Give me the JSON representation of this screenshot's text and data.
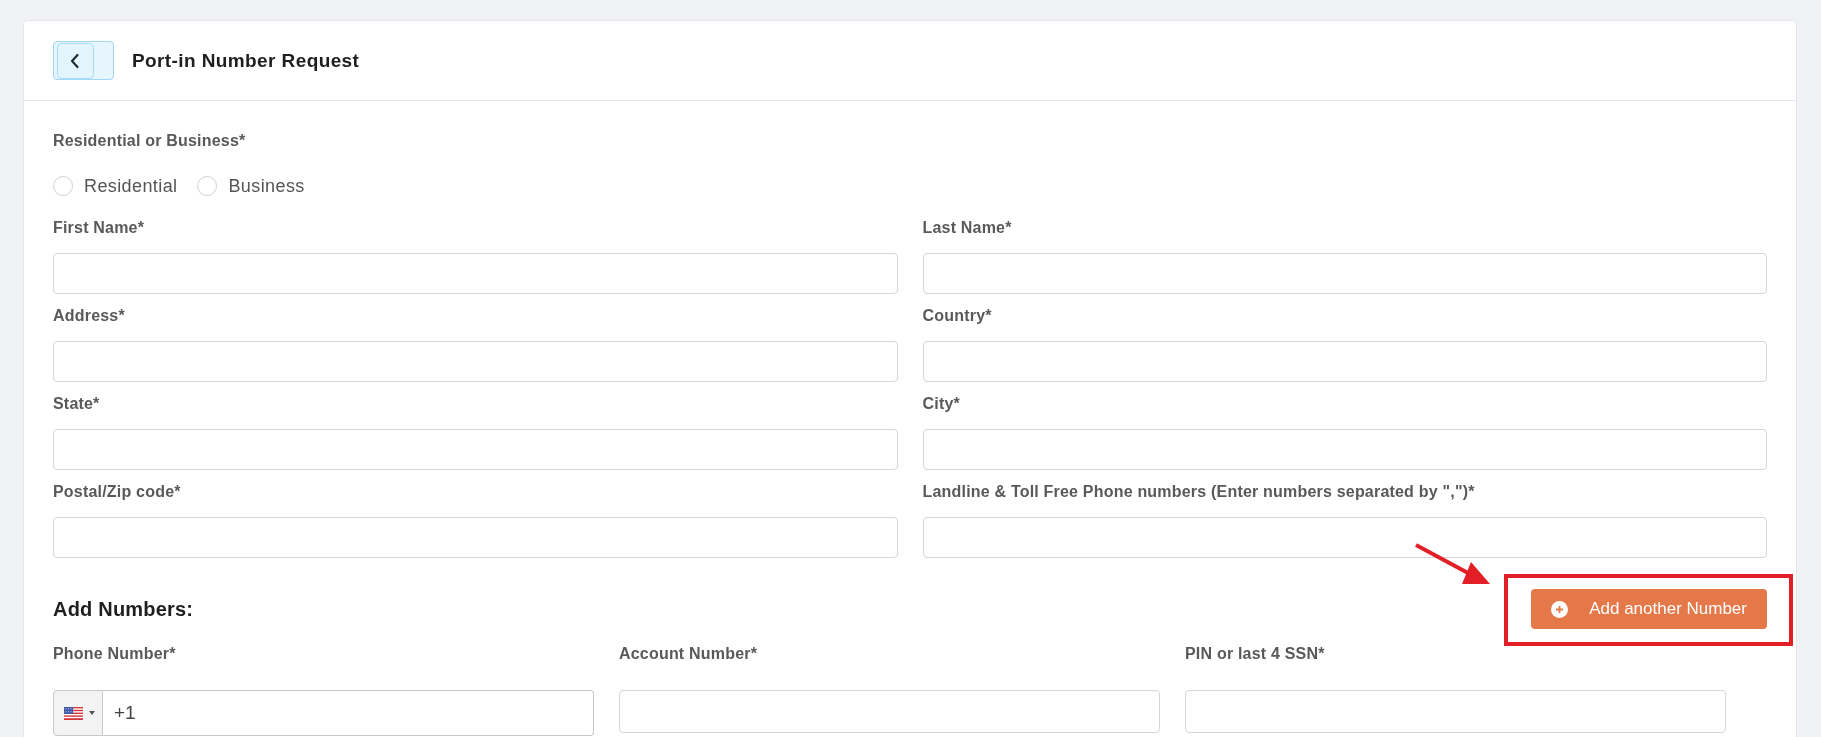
{
  "header": {
    "title": "Port-in Number Request"
  },
  "customer_type": {
    "label": "Residential or Business*",
    "options": [
      {
        "label": "Residential",
        "selected": false
      },
      {
        "label": "Business",
        "selected": false
      }
    ]
  },
  "fields": [
    {
      "label": "First Name*"
    },
    {
      "label": "Last Name*"
    },
    {
      "label": "Address*"
    },
    {
      "label": "Country*"
    },
    {
      "label": "State*"
    },
    {
      "label": "City*"
    },
    {
      "label": "Postal/Zip code*"
    },
    {
      "label": "Landline & Toll Free Phone numbers (Enter numbers separated by \",\")*"
    }
  ],
  "add_numbers": {
    "heading": "Add Numbers:",
    "button": "Add another Number",
    "fields": [
      {
        "kind": "phone",
        "label": "Phone Number*",
        "value": "+1"
      },
      {
        "kind": "text",
        "label": "Account Number*"
      },
      {
        "kind": "text",
        "label": "PIN or last 4 SSN*"
      }
    ]
  }
}
